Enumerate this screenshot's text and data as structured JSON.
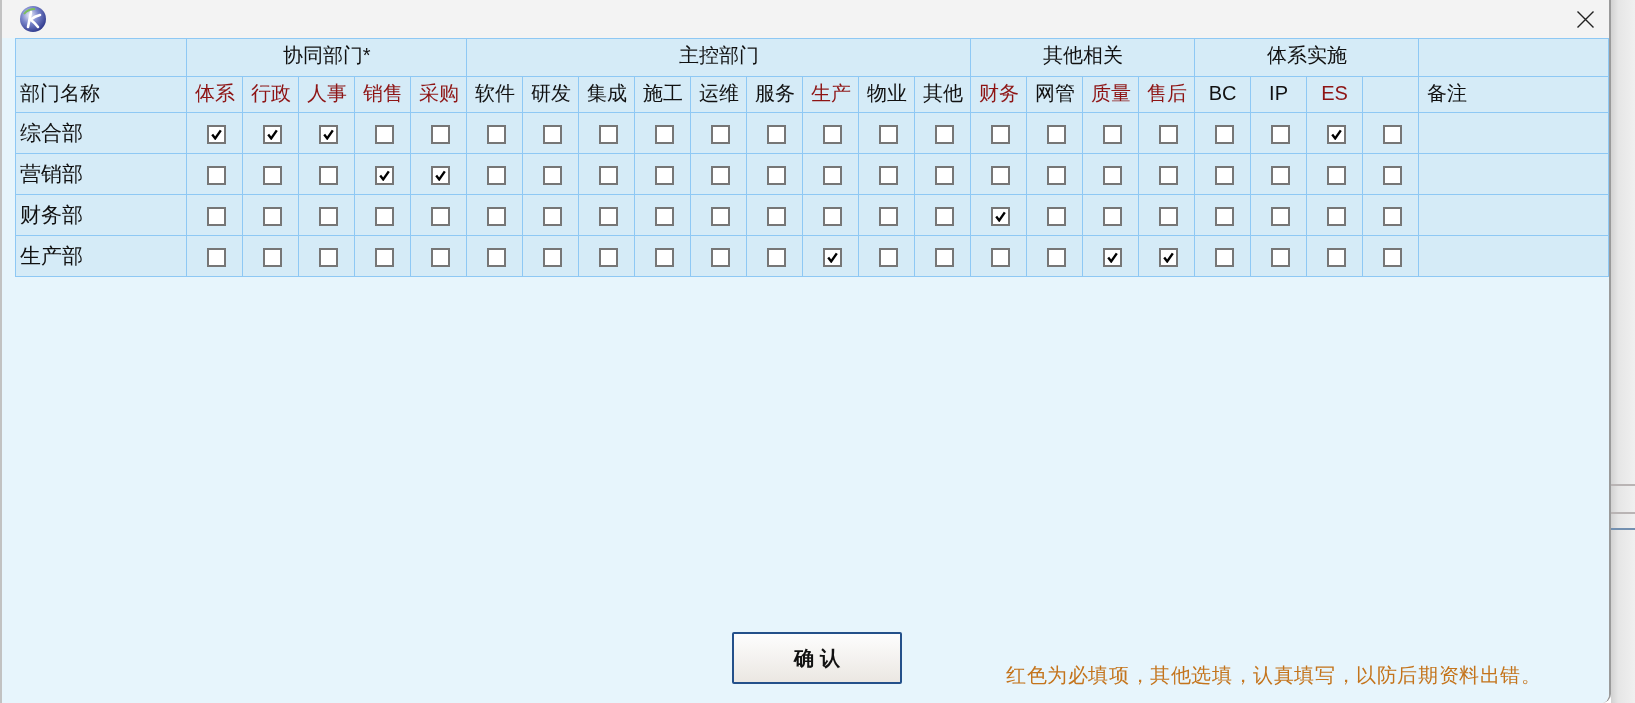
{
  "table": {
    "name_column": "部门名称",
    "groups": [
      {
        "label": "协同部门*",
        "columns": [
          {
            "label": "体系",
            "required": true
          },
          {
            "label": "行政",
            "required": true
          },
          {
            "label": "人事",
            "required": true
          },
          {
            "label": "销售",
            "required": true
          },
          {
            "label": "采购",
            "required": true
          }
        ]
      },
      {
        "label": "主控部门",
        "columns": [
          {
            "label": "软件",
            "required": false
          },
          {
            "label": "研发",
            "required": false
          },
          {
            "label": "集成",
            "required": false
          },
          {
            "label": "施工",
            "required": false
          },
          {
            "label": "运维",
            "required": false
          },
          {
            "label": "服务",
            "required": false
          },
          {
            "label": "生产",
            "required": true
          },
          {
            "label": "物业",
            "required": false
          },
          {
            "label": "其他",
            "required": false
          }
        ]
      },
      {
        "label": "其他相关",
        "columns": [
          {
            "label": "财务",
            "required": true
          },
          {
            "label": "网管",
            "required": false
          },
          {
            "label": "质量",
            "required": true
          },
          {
            "label": "售后",
            "required": true
          }
        ]
      },
      {
        "label": "体系实施",
        "columns": [
          {
            "label": "BC",
            "required": false
          },
          {
            "label": "IP",
            "required": false
          },
          {
            "label": "ES",
            "required": true
          },
          {}
        ]
      }
    ],
    "remark_column": "备注",
    "rows": [
      {
        "name": "综合部",
        "cells": [
          {
            "checked": true
          },
          {
            "checked": true
          },
          {
            "checked": true
          },
          {
            "checked": false
          },
          {
            "checked": false
          },
          {
            "checked": false
          },
          {
            "checked": false
          },
          {
            "checked": false
          },
          {
            "checked": false
          },
          {
            "checked": false
          },
          {
            "checked": false
          },
          {
            "checked": false
          },
          {
            "checked": false
          },
          {
            "checked": false
          },
          {
            "checked": false
          },
          {
            "checked": false
          },
          {
            "checked": false
          },
          {
            "checked": false
          },
          {
            "checked": false
          },
          {
            "checked": false
          },
          {
            "checked": true
          },
          {
            "checked": false
          }
        ]
      },
      {
        "name": "营销部",
        "cells": [
          {
            "checked": false
          },
          {
            "checked": false
          },
          {
            "checked": false
          },
          {
            "checked": true
          },
          {
            "checked": true
          },
          {
            "checked": false
          },
          {
            "checked": false
          },
          {
            "checked": false
          },
          {
            "checked": false
          },
          {
            "checked": false
          },
          {
            "checked": false
          },
          {
            "checked": false
          },
          {
            "checked": false
          },
          {
            "checked": false
          },
          {
            "checked": false
          },
          {
            "checked": false
          },
          {
            "checked": false
          },
          {
            "checked": false
          },
          {
            "checked": false
          },
          {
            "checked": false
          },
          {
            "checked": false
          },
          {
            "checked": false
          }
        ]
      },
      {
        "name": "财务部",
        "cells": [
          {
            "checked": false
          },
          {
            "checked": false
          },
          {
            "checked": false
          },
          {
            "checked": false
          },
          {
            "checked": false
          },
          {
            "checked": false
          },
          {
            "checked": false
          },
          {
            "checked": false
          },
          {
            "checked": false
          },
          {
            "checked": false
          },
          {
            "checked": false
          },
          {
            "checked": false
          },
          {
            "checked": false
          },
          {
            "checked": false
          },
          {
            "checked": true
          },
          {
            "checked": false
          },
          {
            "checked": false
          },
          {
            "checked": false
          },
          {
            "checked": false
          },
          {
            "checked": false
          },
          {
            "checked": false
          },
          {
            "checked": false
          }
        ]
      },
      {
        "name": "生产部",
        "cells": [
          {
            "checked": false
          },
          {
            "checked": false
          },
          {
            "checked": false
          },
          {
            "checked": false
          },
          {
            "checked": false
          },
          {
            "checked": false
          },
          {
            "checked": false
          },
          {
            "checked": false
          },
          {
            "checked": false
          },
          {
            "checked": false
          },
          {
            "checked": false
          },
          {
            "checked": true
          },
          {
            "checked": false
          },
          {
            "checked": false
          },
          {
            "checked": false
          },
          {
            "checked": false
          },
          {
            "checked": true
          },
          {
            "checked": true
          },
          {
            "checked": false
          },
          {
            "checked": false
          },
          {
            "checked": false
          },
          {
            "checked": false
          }
        ]
      }
    ]
  },
  "footer": {
    "confirm_button": "确 认",
    "note": "红色为必填项，其他选填，认真填写，以防后期资料出错。"
  }
}
